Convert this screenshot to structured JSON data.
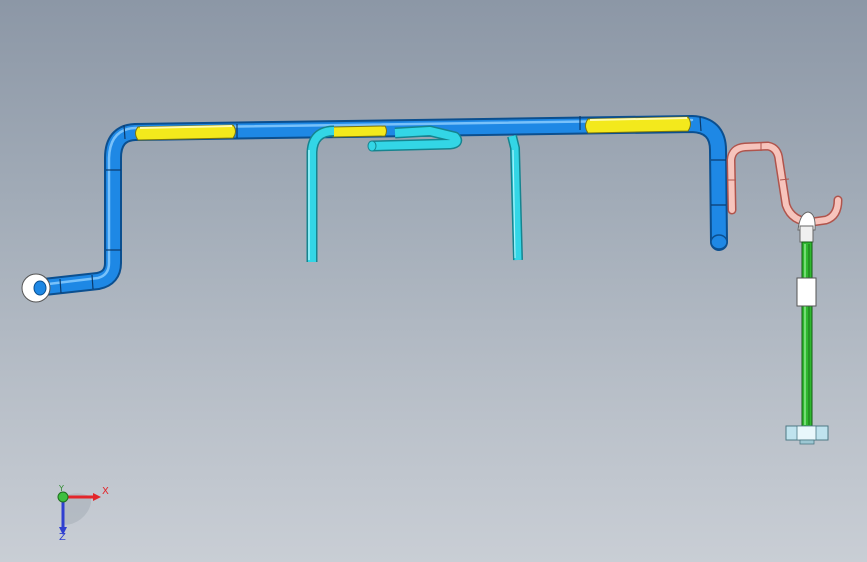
{
  "viewport": {
    "background_top": "#8c97a6",
    "background_bottom": "#c9ced5"
  },
  "model": {
    "main_pipe_color": "#1e88e5",
    "main_pipe_edge": "#0b4f8f",
    "insulation_color": "#f3e91c",
    "branch_pipe_color": "#33d6e6",
    "return_pipe_color": "#f2a8a0",
    "stem_color": "#2fb82f",
    "fitting_color": "#ffffff",
    "base_color": "#bfe3ee"
  },
  "triad": {
    "x_label": "X",
    "y_label": "Y",
    "z_label": "Z",
    "x_color": "#e3262b",
    "y_color": "#3fbf3f",
    "z_color": "#2f3fd0"
  }
}
